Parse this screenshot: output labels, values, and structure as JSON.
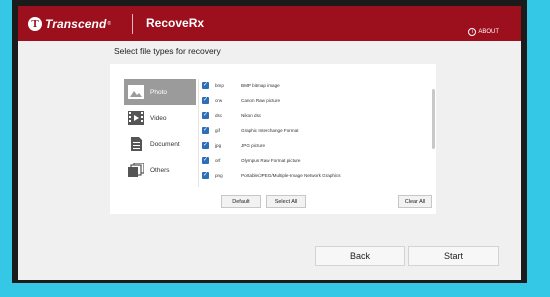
{
  "window": {
    "brand": "Transcend",
    "app_name": "RecoveRx",
    "about_label": "ABOUT"
  },
  "heading": "Select file types for recovery",
  "categories": [
    {
      "label": "Photo",
      "icon": "photo-icon",
      "selected": true
    },
    {
      "label": "Video",
      "icon": "video-icon",
      "selected": false
    },
    {
      "label": "Document",
      "icon": "document-icon",
      "selected": false
    },
    {
      "label": "Others",
      "icon": "others-icon",
      "selected": false
    }
  ],
  "file_types": [
    {
      "ext": "bmp",
      "desc": "BMP bitmap image",
      "checked": true
    },
    {
      "ext": "crw",
      "desc": "Canon Raw picture",
      "checked": true
    },
    {
      "ext": "dsc",
      "desc": "Nikon dsc",
      "checked": true
    },
    {
      "ext": "gif",
      "desc": "Graphic Interchange Format",
      "checked": true
    },
    {
      "ext": "jpg",
      "desc": "JPG picture",
      "checked": true
    },
    {
      "ext": "orf",
      "desc": "Olympus Raw Format picture",
      "checked": true
    },
    {
      "ext": "png",
      "desc": "Portable/JPEG/Multiple-Image Network Graphics",
      "checked": true
    }
  ],
  "buttons": {
    "default": "Default",
    "select_all": "Select All",
    "clear_all": "Clear All",
    "back": "Back",
    "start": "Start"
  },
  "colors": {
    "titlebar": "#9c0f1d",
    "checkbox": "#2d6fb6",
    "background": "#35c7e6"
  }
}
